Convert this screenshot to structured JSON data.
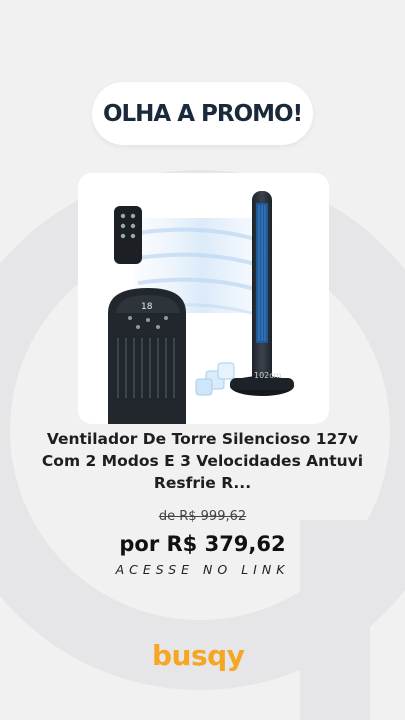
{
  "promo": {
    "label": "OLHA A PROMO!"
  },
  "product": {
    "title": "Ventilador De Torre Silencioso 127v Com 2 Modos E 3 Velocidades Antuvi Resfrie R...",
    "image_label": "102cm",
    "display_reading": "18"
  },
  "pricing": {
    "old_price": "de R$ 999,62",
    "price": "por R$ 379,62"
  },
  "cta": {
    "label": "ACESSE NO LINK"
  },
  "brand": {
    "logo_text": "busqy",
    "color": "#f5a623"
  },
  "colors": {
    "background": "#f1f1f2",
    "heading": "#1b2a3a",
    "fan_blue": "#2f7fd6"
  }
}
